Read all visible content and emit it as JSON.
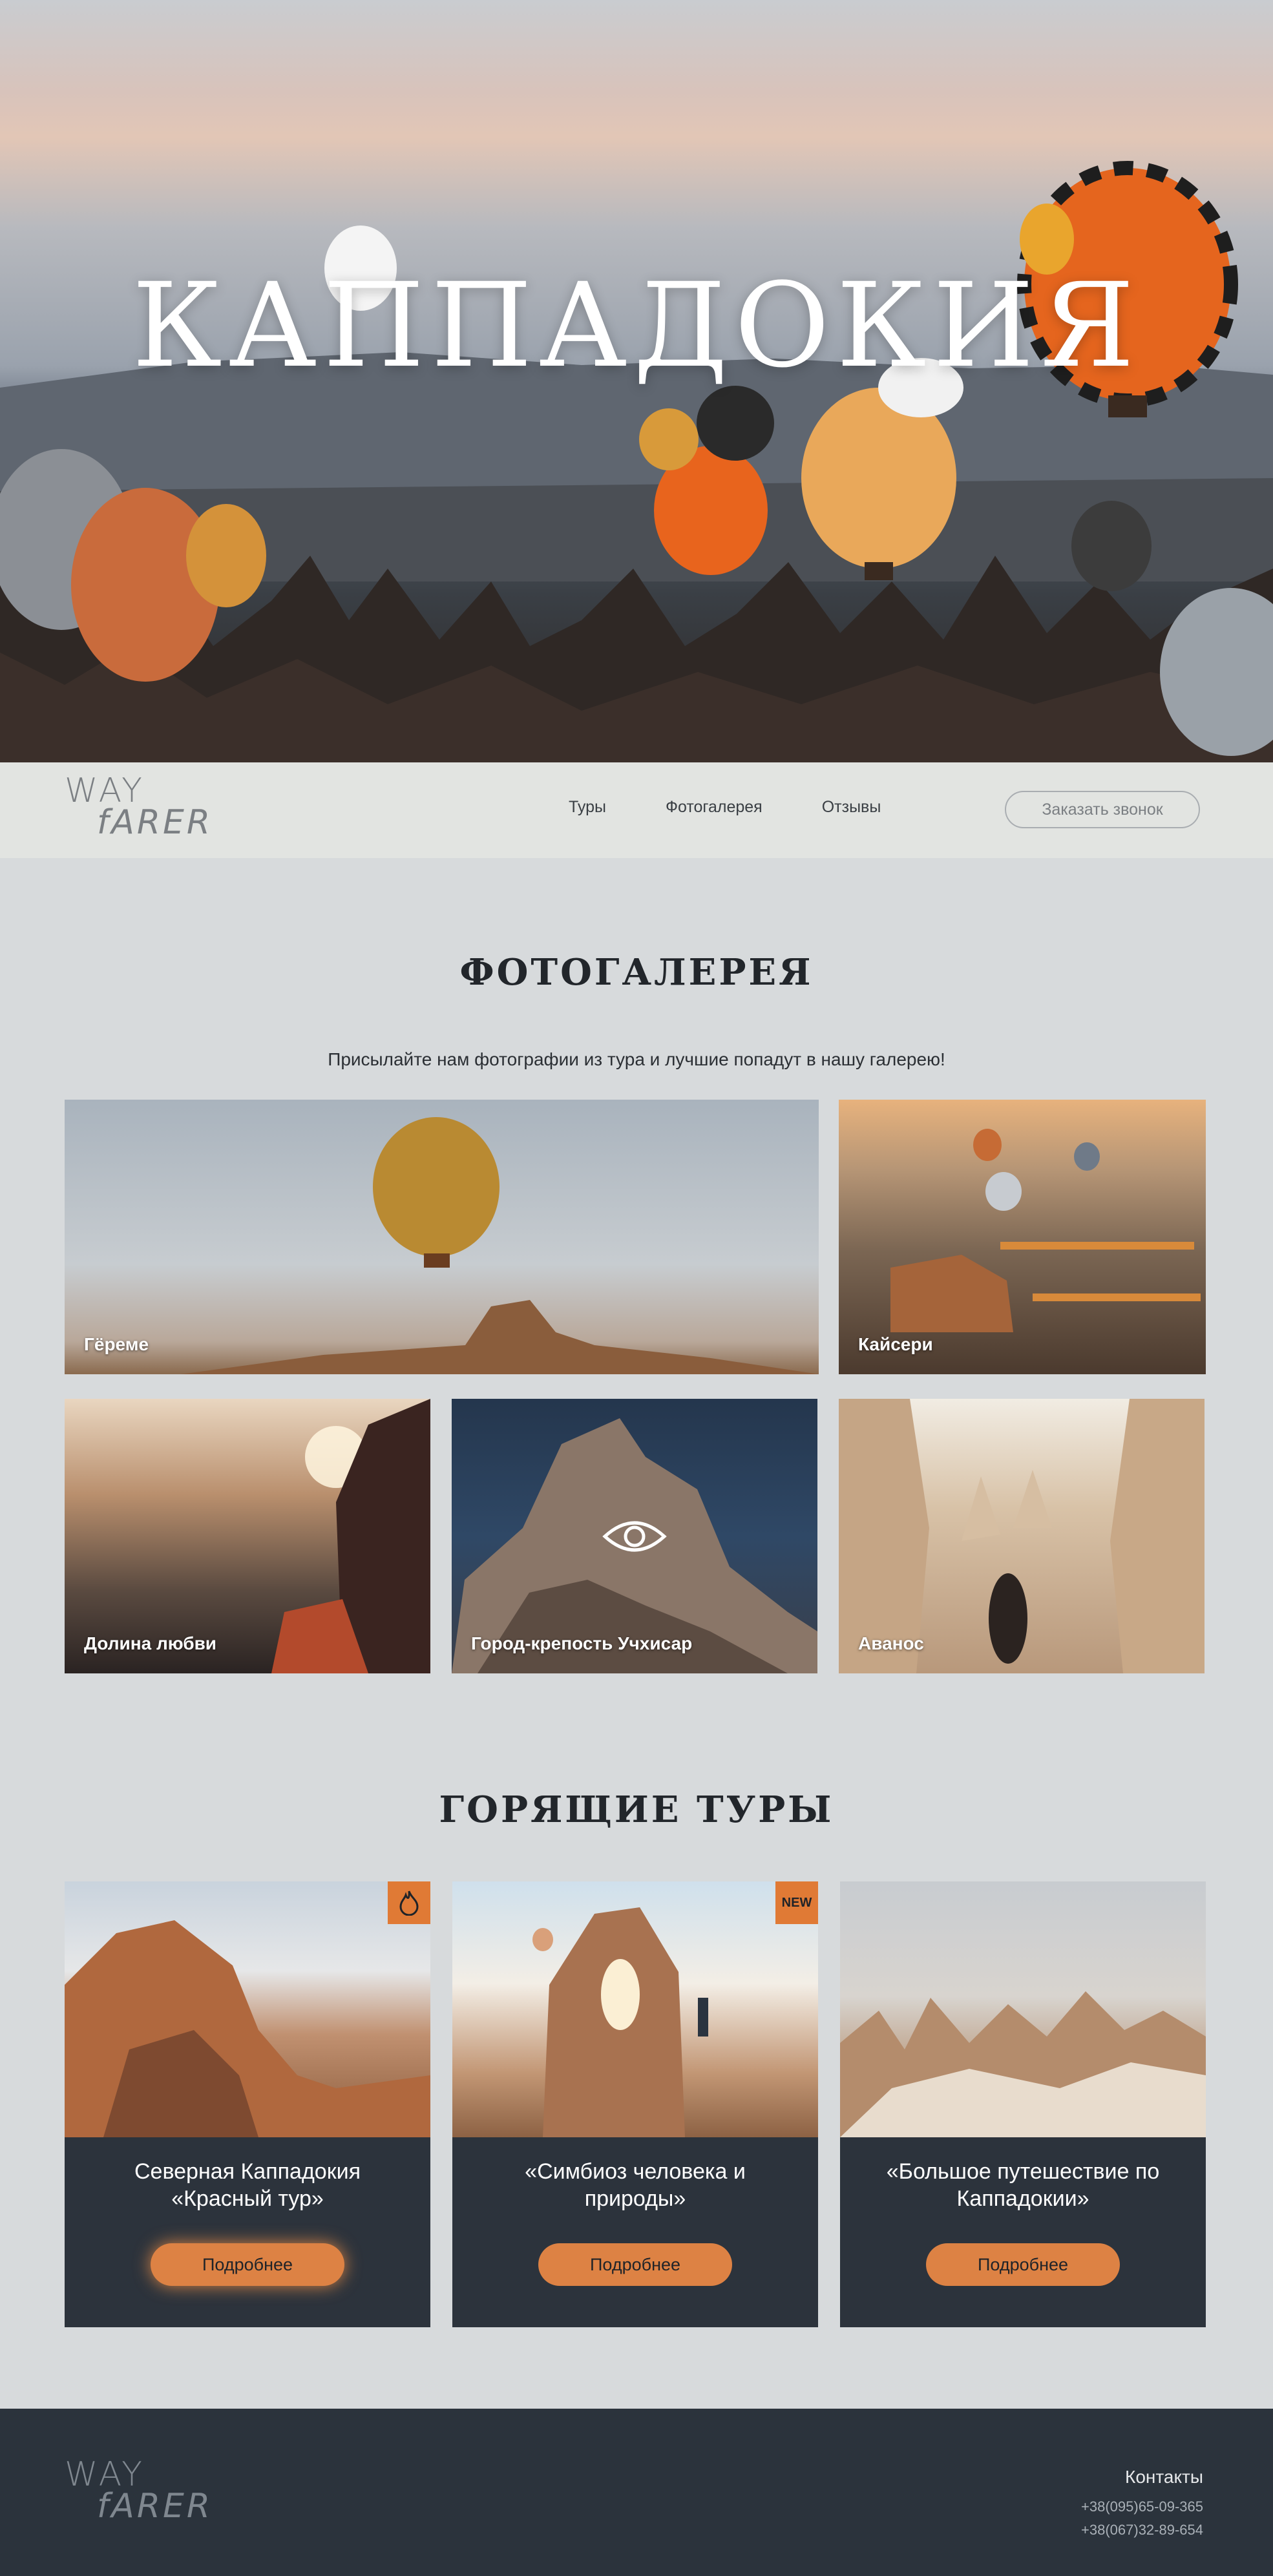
{
  "hero": {
    "title": "КАППАДОКИЯ"
  },
  "logo": {
    "line1": "WAY",
    "line2": "fARER"
  },
  "nav": {
    "links": [
      "Туры",
      "Фотогалерея",
      "Отзывы"
    ],
    "cta": "Заказать звонок"
  },
  "gallery": {
    "title": "ФОТОГАЛЕРЕЯ",
    "subtitle": "Присылайте нам фотографии из тура и лучшие попадут в нашу галерею!",
    "items": [
      "Гёреме",
      "Кайсери",
      "Долина любви",
      "Город-крепость Учхисар",
      "Аванос"
    ]
  },
  "tours": {
    "title": "ГОРЯЩИЕ ТУРЫ",
    "items": [
      {
        "line1": "Северная Каппадокия",
        "line2": "«Красный тур»",
        "button": "Подробнее",
        "badge_icon": "fire-icon"
      },
      {
        "line1": "«Симбиоз человека и",
        "line2": "природы»",
        "button": "Подробнее",
        "badge": "NEW"
      },
      {
        "line1": "«Большое путешествие по",
        "line2": "Каппадокии»",
        "button": "Подробнее"
      }
    ]
  },
  "footer": {
    "contacts_title": "Контакты",
    "phones": [
      "+38(095)65-09-365",
      "+38(067)32-89-654"
    ]
  },
  "colors": {
    "accent": "#dd8244",
    "dark": "#2c333c",
    "page_bg": "#d7dadc"
  }
}
